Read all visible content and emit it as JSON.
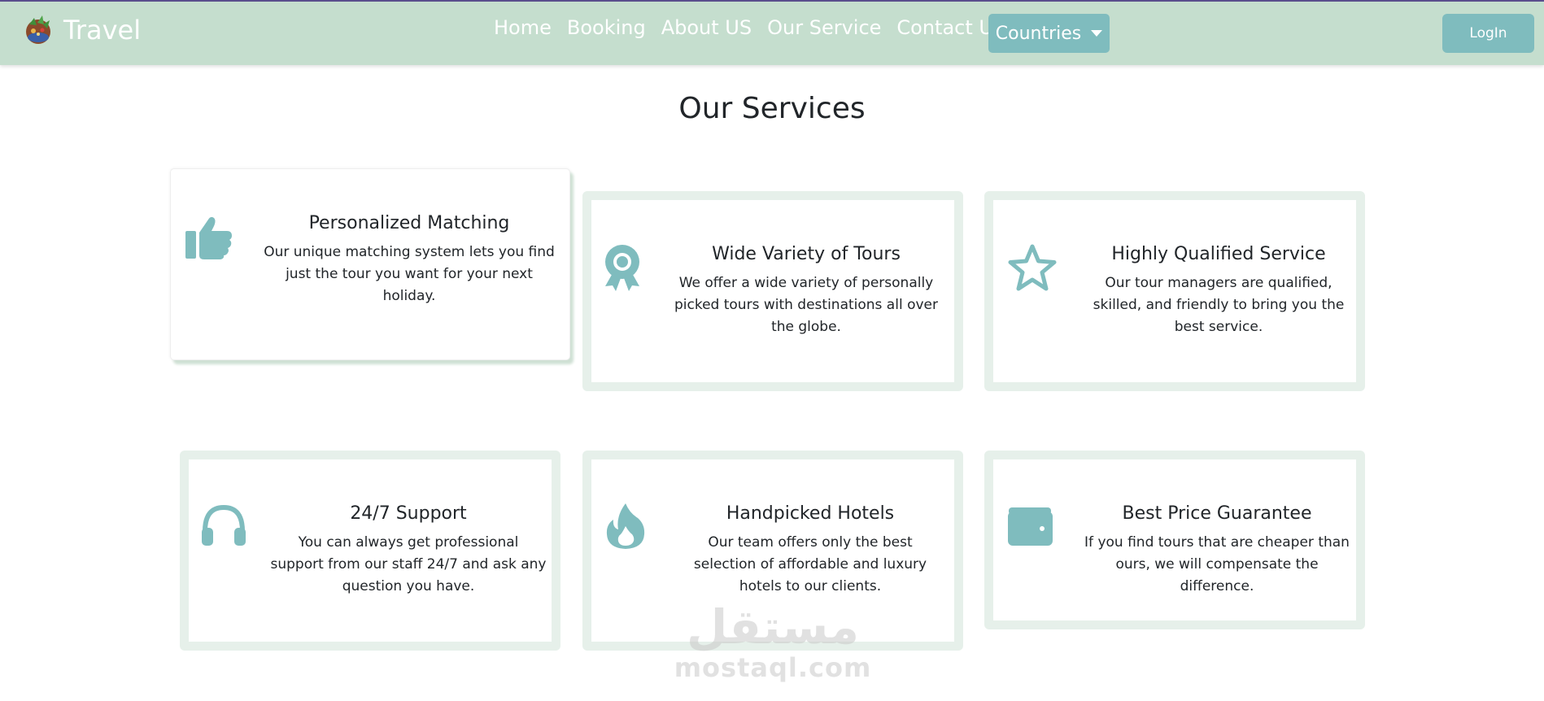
{
  "brand": {
    "name": "Travel"
  },
  "nav": {
    "links": [
      "Home",
      "Booking",
      "About US",
      "Our Service",
      "Contact Us"
    ],
    "dropdown_label": "Countries",
    "login_label": "LogIn"
  },
  "colors": {
    "navbar_bg": "#c5dece",
    "accent": "#7fbcbe",
    "card_border": "#e6f0ea"
  },
  "section": {
    "title": "Our Services"
  },
  "services": [
    {
      "icon": "thumbs-up-icon",
      "title": "Personalized Matching",
      "text": "Our unique matching system lets you find just the tour you want for your next holiday."
    },
    {
      "icon": "award-icon",
      "title": "Wide Variety of Tours",
      "text": "We offer a wide variety of personally picked tours with destinations all over the globe."
    },
    {
      "icon": "star-icon",
      "title": "Highly Qualified Service",
      "text": "Our tour managers are qualified, skilled, and friendly to bring you the best service."
    },
    {
      "icon": "headphones-icon",
      "title": "24/7 Support",
      "text": "You can always get professional support from our staff 24/7 and ask any question you have."
    },
    {
      "icon": "fire-icon",
      "title": "Handpicked Hotels",
      "text": "Our team offers only the best selection of affordable and luxury hotels to our clients."
    },
    {
      "icon": "wallet-icon",
      "title": "Best Price Guarantee",
      "text": "If you find tours that are cheaper than ours, we will compensate the difference."
    }
  ],
  "watermark": {
    "arabic": "مستقل",
    "latin": "mostaql.com"
  }
}
